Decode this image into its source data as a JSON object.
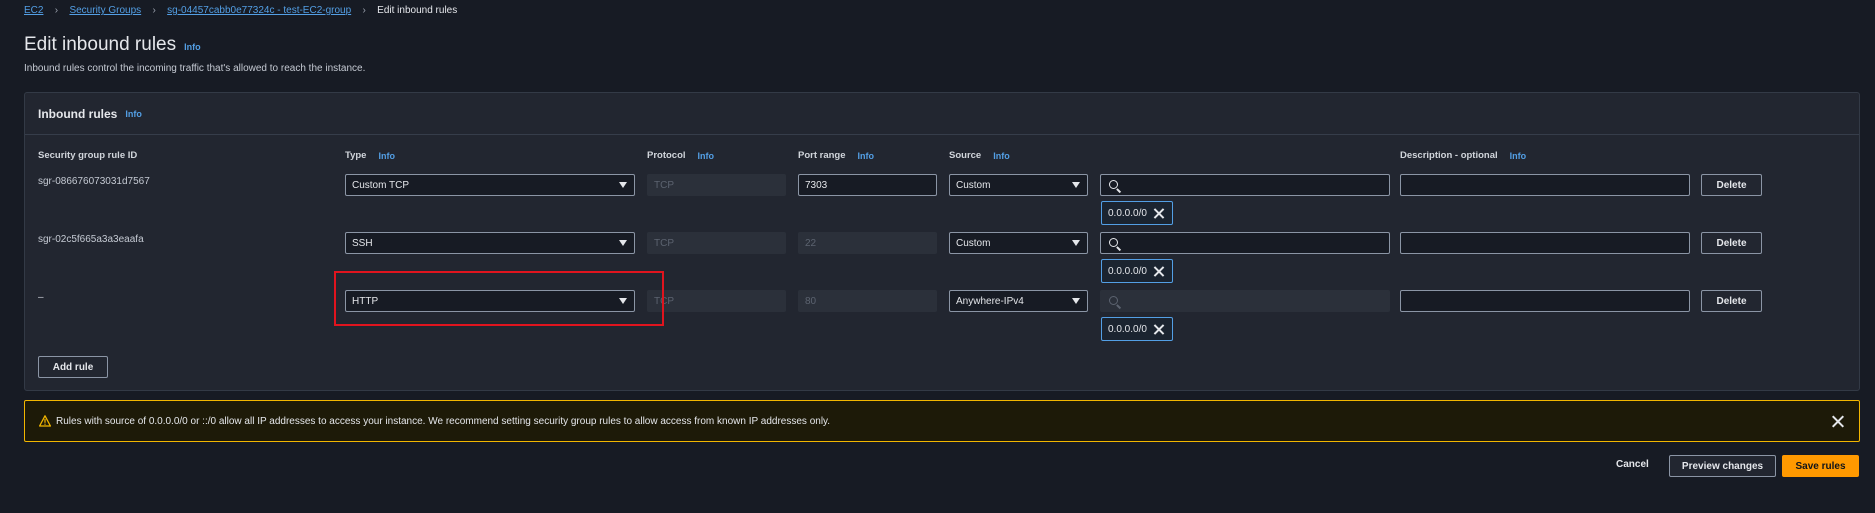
{
  "breadcrumb": {
    "items": [
      "EC2",
      "Security Groups",
      "sg-04457cabb0e77324c - test-EC2-group"
    ],
    "current": "Edit inbound rules"
  },
  "page": {
    "title": "Edit inbound rules",
    "info": "Info",
    "description": "Inbound rules control the incoming traffic that's allowed to reach the instance."
  },
  "panel": {
    "title": "Inbound rules",
    "info": "Info",
    "columns": {
      "rule_id": "Security group rule ID",
      "type": "Type",
      "protocol": "Protocol",
      "port_range": "Port range",
      "source": "Source",
      "description": "Description - optional",
      "info": "Info"
    },
    "rules": [
      {
        "id": "sgr-086676073031d7567",
        "type": "Custom TCP",
        "protocol": "TCP",
        "port": "7303",
        "source": "Custom",
        "cidr": "0.0.0.0/0",
        "delete": "Delete"
      },
      {
        "id": "sgr-02c5f665a3a3eaafa",
        "type": "SSH",
        "protocol": "TCP",
        "port": "22",
        "source": "Custom",
        "cidr": "0.0.0.0/0",
        "delete": "Delete"
      },
      {
        "id": "–",
        "type": "HTTP",
        "protocol": "TCP",
        "port": "80",
        "source": "Anywhere-IPv4",
        "cidr": "0.0.0.0/0",
        "delete": "Delete"
      }
    ],
    "add_rule": "Add rule"
  },
  "warning": {
    "text": "Rules with source of 0.0.0.0/0 or ::/0 allow all IP addresses to access your instance. We recommend setting security group rules to allow access from known IP addresses only."
  },
  "footer": {
    "cancel": "Cancel",
    "preview": "Preview changes",
    "save": "Save rules"
  },
  "colors": {
    "accent": "#539fe5",
    "primary_button": "#ff9900",
    "warning_border": "#f2b600",
    "highlight": "#e0141e"
  }
}
